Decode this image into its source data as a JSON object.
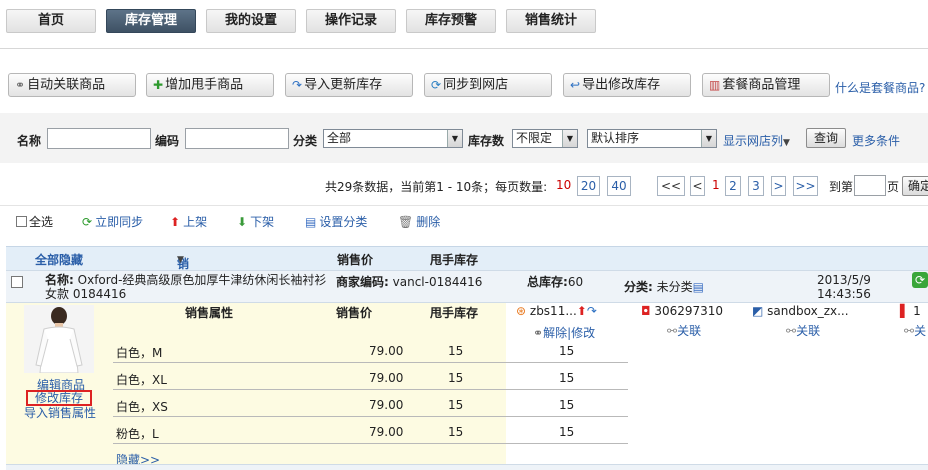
{
  "nav": {
    "tabs": [
      {
        "label": "首页"
      },
      {
        "label": "库存管理"
      },
      {
        "label": "我的设置"
      },
      {
        "label": "操作记录"
      },
      {
        "label": "库存预警"
      },
      {
        "label": "销售统计"
      }
    ],
    "active": "库存管理"
  },
  "actions": {
    "buttons": [
      {
        "label": "自动关联商品",
        "icon": "link-icon"
      },
      {
        "label": "增加甩手商品",
        "icon": "plus-icon"
      },
      {
        "label": "导入更新库存",
        "icon": "import-arrow-icon"
      },
      {
        "label": "同步到网店",
        "icon": "sync-icon"
      },
      {
        "label": "导出修改库存",
        "icon": "export-arrow-icon"
      },
      {
        "label": "套餐商品管理",
        "icon": "bundle-icon"
      }
    ],
    "help_link": "什么是套餐商品?"
  },
  "search": {
    "name_label": "名称",
    "code_label": "编码",
    "category_label": "分类",
    "category_value": "全部",
    "stock_label": "库存数",
    "stock_value": "不限定",
    "sort_value": "默认排序",
    "show_shops": "显示网店列",
    "query_btn": "查询",
    "more": "更多条件"
  },
  "pager": {
    "summary": "共29条数据，当前第1 - 10条；每页数量:",
    "size_current": "10",
    "sizes": [
      "20",
      "40"
    ],
    "first": "<<",
    "prev": "<",
    "pages": [
      "1",
      "2",
      "3"
    ],
    "next": ">",
    "last": ">>",
    "goto_label": "到第",
    "page_suffix": "页",
    "confirm": "确定"
  },
  "toolbar": {
    "select_all": "全选",
    "sync_now": "立即同步",
    "shelve": "上架",
    "unshelve": "下架",
    "set_category": "设置分类",
    "delete": "删除"
  },
  "table": {
    "headers": {
      "hide_all": "全部隐藏",
      "sale_attr": "销售属性",
      "price": "销售价",
      "stock": "甩手库存"
    }
  },
  "product": {
    "name_label": "名称:",
    "name": "Oxford-经典高级原色加厚牛津纺休闲长袖衬衫女款 0184416",
    "code_label": "商家编码:",
    "code": "vancl-0184416",
    "total_label": "总库存:",
    "total": "60",
    "cat_label": "分类:",
    "cat": "未分类",
    "date": "2013/5/9",
    "time": "14:43:56",
    "links": {
      "edit": "编辑商品",
      "modify_stock": "修改库存",
      "import_attr": "导入销售属性"
    },
    "sub_headers": {
      "attr": "销售属性",
      "price": "销售价",
      "stock": "甩手库存"
    },
    "variants": [
      {
        "attr": "白色，M",
        "price": "79.00",
        "stock": "15",
        "shop": "15"
      },
      {
        "attr": "白色，XL",
        "price": "79.00",
        "stock": "15",
        "shop": "15"
      },
      {
        "attr": "白色，XS",
        "price": "79.00",
        "stock": "15",
        "shop": "15"
      },
      {
        "attr": "粉色，L",
        "price": "79.00",
        "stock": "15",
        "shop": "15"
      }
    ],
    "collapse": "隐藏>>",
    "shops": [
      {
        "name": "zbs11...",
        "actions": "解除|修改"
      },
      {
        "name": "306297310",
        "actions": "关联"
      },
      {
        "name": "sandbox_zx...",
        "actions": "关联"
      },
      {
        "name": "1",
        "actions": "关"
      }
    ]
  },
  "colors": {
    "accent": "#2a5ea8",
    "active_tab": "#4a5e72",
    "price_red": "#cc0000"
  }
}
